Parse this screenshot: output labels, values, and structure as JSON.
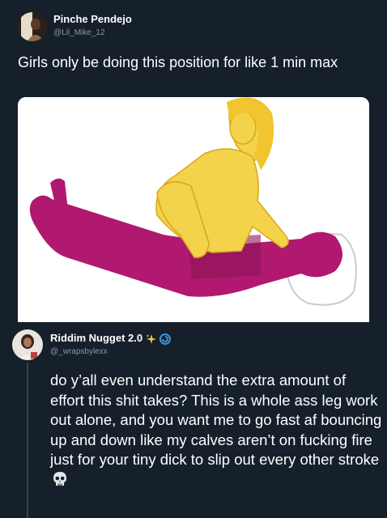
{
  "tweet_top": {
    "display_name": "Pinche Pendejo",
    "handle": "@Lil_Mike_12",
    "text": "Girls only be doing this position for like 1 min max"
  },
  "tweet_reply": {
    "display_name": "Riddim Nugget 2.0",
    "handle": "@_wrapsbylexx",
    "name_emoji": [
      "sparkles-icon",
      "cyclone-icon"
    ],
    "text": "do y’all even understand the extra amount of effort this shit takes? This is a whole ass leg work out alone, and you want me to go fast af bouncing up and down like my calves aren’t on fucking fire just for your tiny dick to slip out every other stroke",
    "end_emoji": "skull-icon"
  },
  "colors": {
    "background": "#15202b",
    "text": "#ffffff",
    "muted": "#8899a6",
    "figure_top": "#f3d34a",
    "figure_bottom": "#b0196f"
  }
}
